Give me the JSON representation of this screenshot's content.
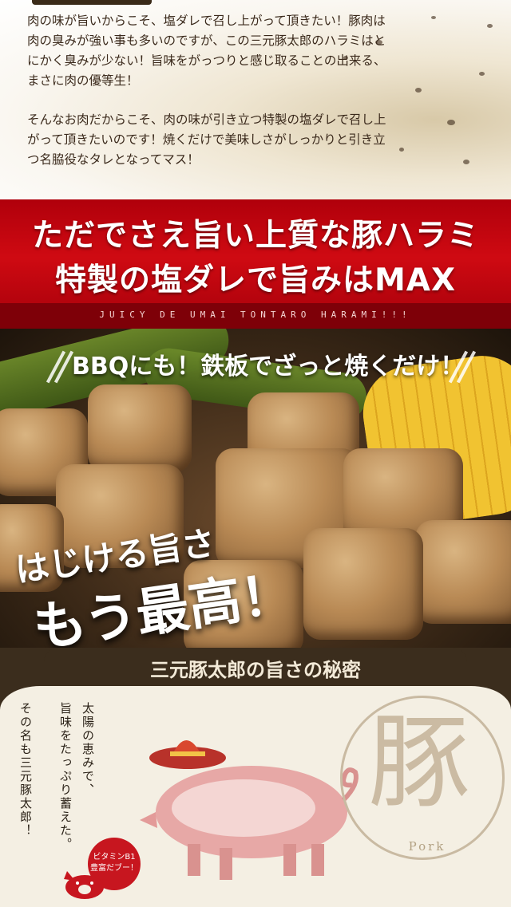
{
  "intro": {
    "paragraph1": "肉の味が旨いからこそ、塩ダレで召し上がって頂きたい！豚肉は肉の臭みが強い事も多いのですが、この三元豚太郎のハラミはとにかく臭みが少ない！旨味をがっつりと感じ取ることの出来る、まさに肉の優等生！",
    "paragraph2": "そんなお肉だからこそ、肉の味が引き立つ特製の塩ダレで召し上がって頂きたいのです！焼くだけで美味しさがしっかりと引き立つ名脇役なタレとなってマス！"
  },
  "banner": {
    "line1": "ただでさえ旨い上質な豚ハラミ",
    "line2": "特製の塩ダレで旨みはMAX",
    "subline": "JUICY DE UMAI TONTARO HARAMI!!!"
  },
  "food": {
    "caption": "BBQにも！鉄板でざっと焼くだけ！",
    "headline1": "はじける旨さ",
    "headline2": "もう最高！"
  },
  "secret": {
    "title": "三元豚太郎の旨さの秘密",
    "col1": "太陽の恵みで、",
    "col2": "旨味をたっぷり蓄えた。",
    "col3": "その名も三元豚太郎！",
    "badge_line1": "ビタミンB1",
    "badge_line2": "豊富だブー！",
    "kanji": "豚",
    "kanji_label": "Pork"
  },
  "colors": {
    "banner_red": "#cf0a12",
    "brown": "#3b2d1d",
    "cream": "#f4efe3"
  }
}
